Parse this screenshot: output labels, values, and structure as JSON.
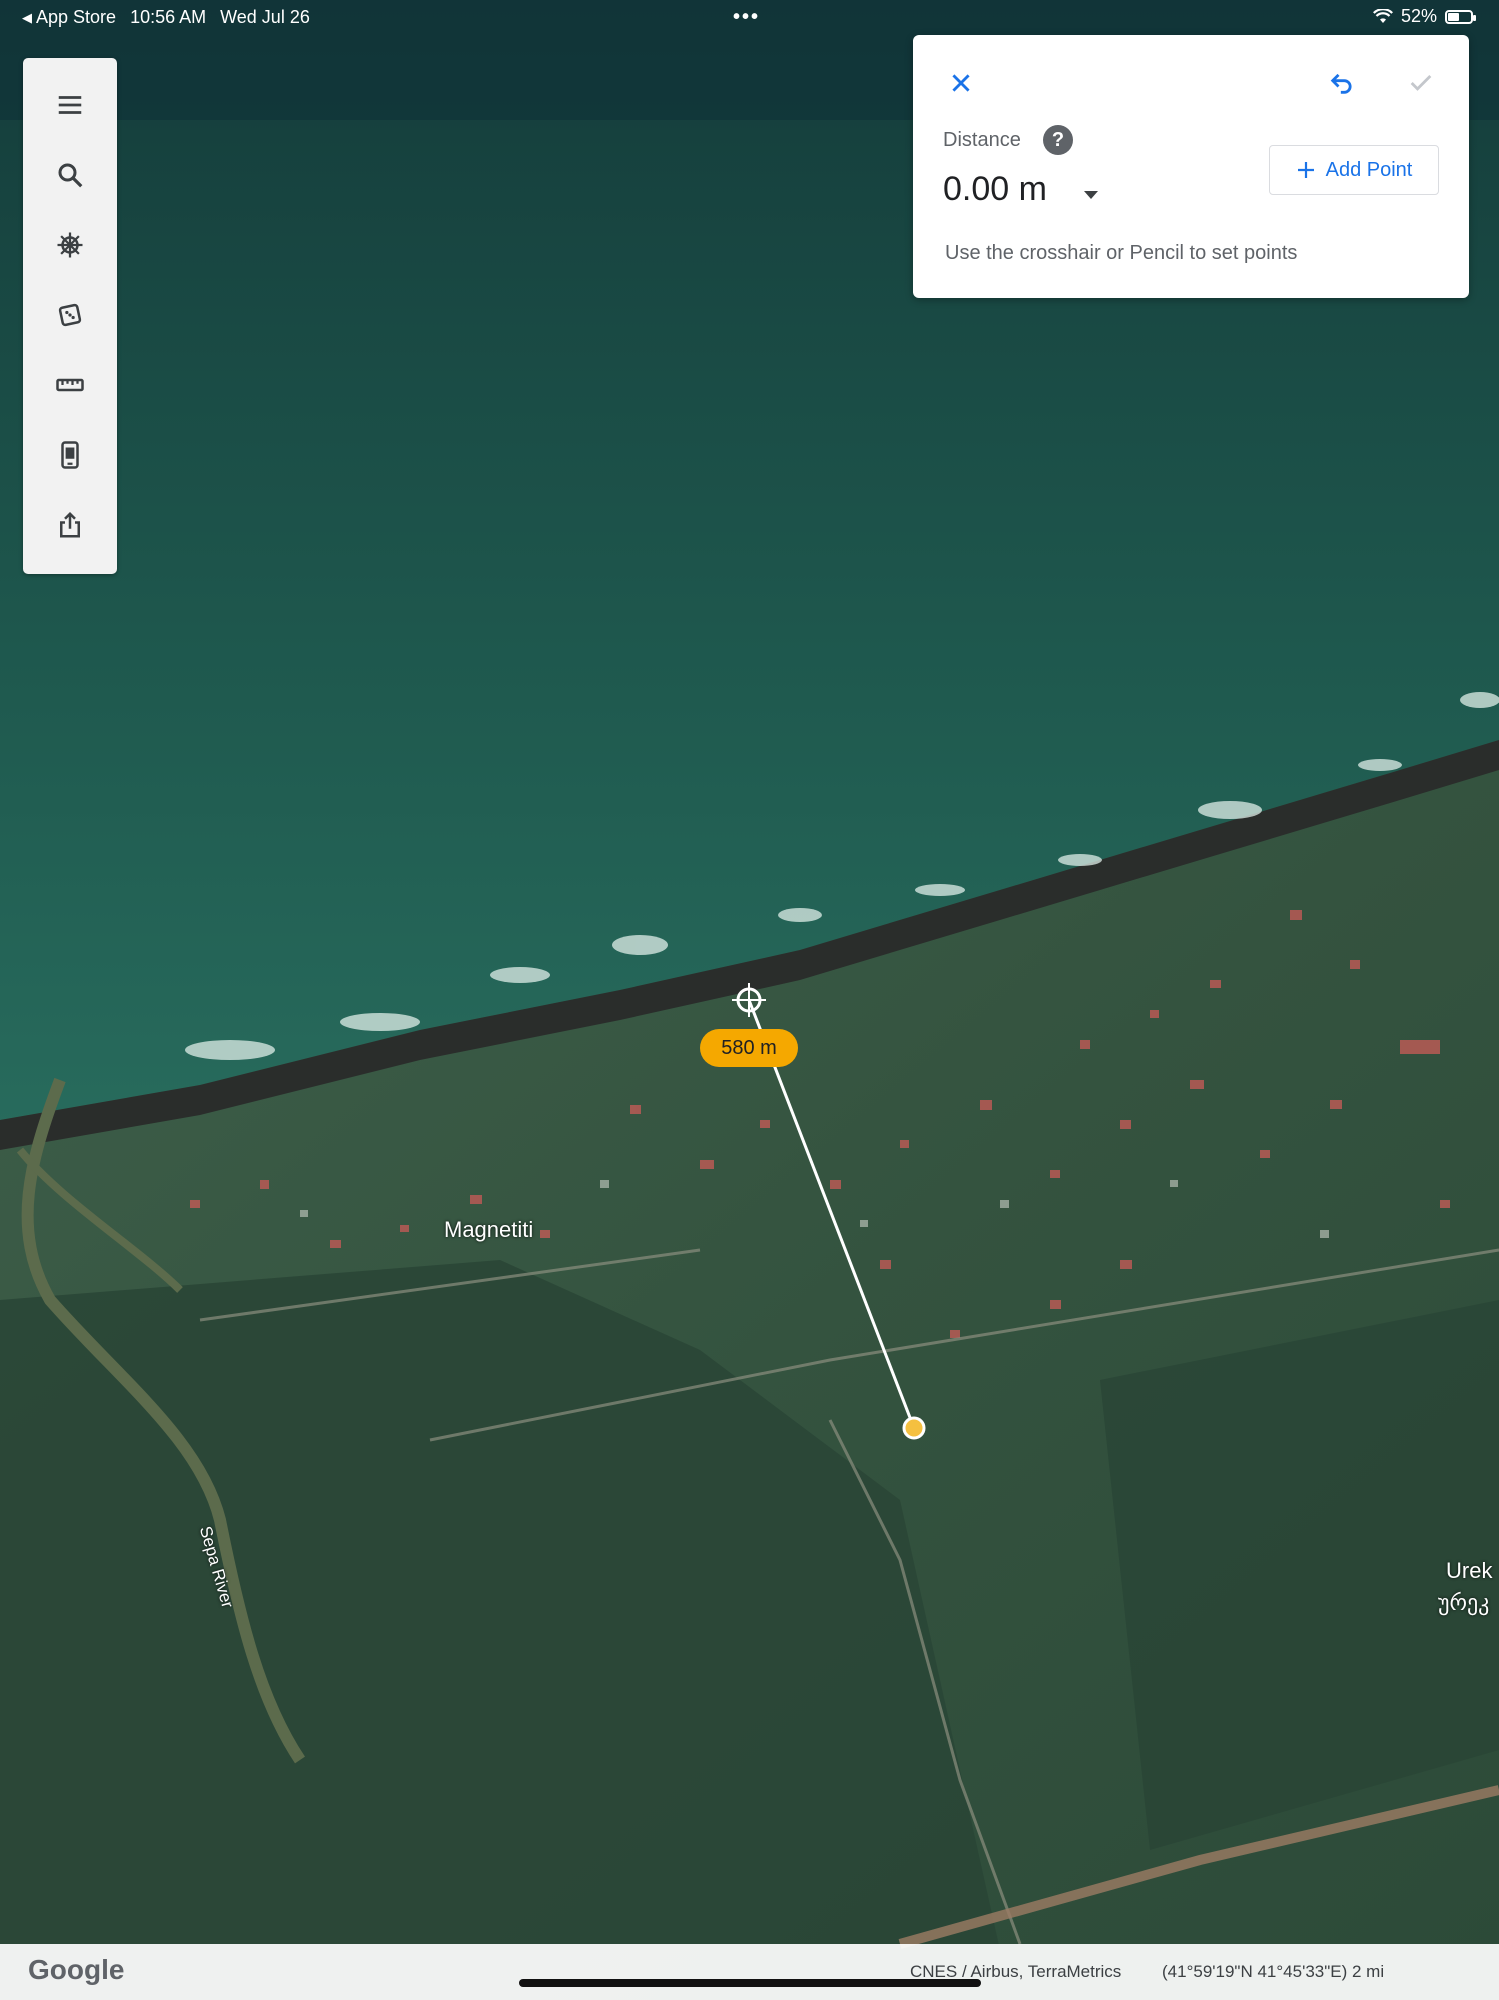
{
  "status_bar": {
    "back_app": "App Store",
    "time": "10:56 AM",
    "date": "Wed Jul 26",
    "more_dots": "•••",
    "battery_percent": "52%",
    "battery_level": 0.52
  },
  "toolbar": {
    "items": [
      {
        "name": "menu",
        "icon": "menu-icon"
      },
      {
        "name": "search",
        "icon": "search-icon"
      },
      {
        "name": "voyager",
        "icon": "ship-wheel-icon"
      },
      {
        "name": "feeling-lucky",
        "icon": "dice-icon"
      },
      {
        "name": "measure",
        "icon": "ruler-icon"
      },
      {
        "name": "projects",
        "icon": "phone-card-icon"
      },
      {
        "name": "share",
        "icon": "share-icon"
      }
    ]
  },
  "measure_panel": {
    "distance_label": "Distance",
    "help_glyph": "?",
    "distance_value": "0.00 m",
    "add_point_label": "Add Point",
    "hint": "Use the crosshair or Pencil to set points",
    "accent_color": "#1a73e8"
  },
  "map": {
    "segment_label": "580 m",
    "places": {
      "magnetiti": "Magnetiti",
      "ureki_latin": "Urek",
      "ureki_georgian": "ურეკ"
    },
    "river": "Sepa River",
    "badge_color": "#f5a800"
  },
  "bottom_bar": {
    "logo": "Google",
    "attribution": "CNES / Airbus, TerraMetrics",
    "coordinates": "(41°59'19\"N 41°45'33\"E) 2 mi"
  }
}
